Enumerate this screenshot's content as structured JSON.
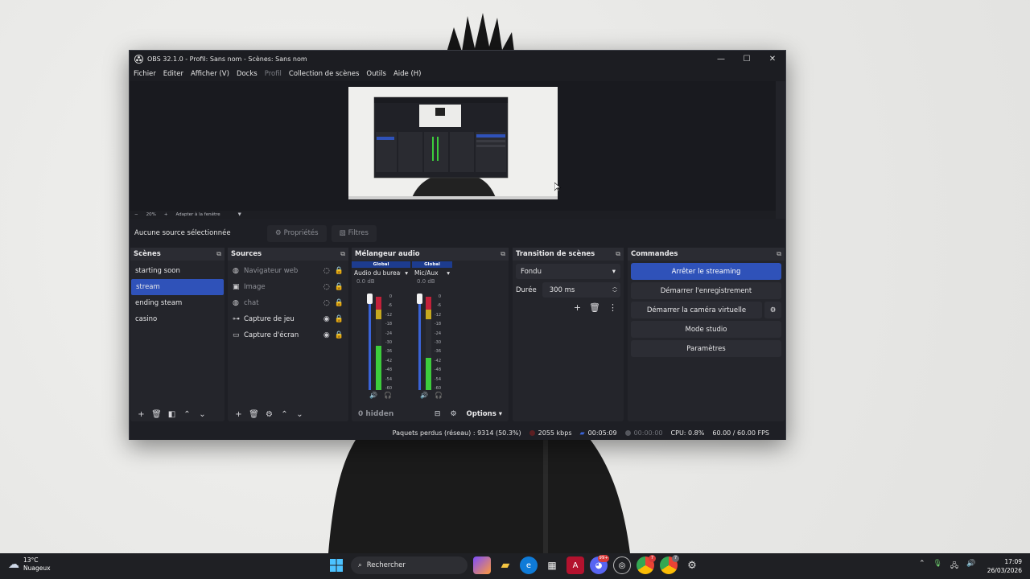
{
  "window": {
    "title": "OBS 32.1.0 - Profil: Sans nom - Scènes: Sans nom",
    "controls": {
      "minimize": "—",
      "maximize": "☐",
      "close": "✕"
    }
  },
  "menu": [
    "Fichier",
    "Editer",
    "Afficher (V)",
    "Docks",
    "Profil",
    "Collection de scènes",
    "Outils",
    "Aide (H)"
  ],
  "zoom_bar": {
    "minus": "−",
    "zoom": "20%",
    "plus": "+",
    "fit": "Adapter à la fenêtre"
  },
  "source_toolbar": {
    "no_selection": "Aucune source sélectionnée",
    "properties": "Propriétés",
    "filters": "Filtres"
  },
  "scenes": {
    "title": "Scènes",
    "items": [
      "starting soon",
      "stream",
      "ending steam",
      "casino"
    ],
    "selected_index": 1
  },
  "sources": {
    "title": "Sources",
    "items": [
      {
        "name": "Navigateur web",
        "icon": "globe-icon",
        "visible": false
      },
      {
        "name": "Image",
        "icon": "image-icon",
        "visible": false
      },
      {
        "name": "chat",
        "icon": "globe-icon",
        "visible": false
      },
      {
        "name": "Capture de jeu",
        "icon": "gamepad-icon",
        "visible": true
      },
      {
        "name": "Capture d'écran",
        "icon": "monitor-icon",
        "visible": true
      }
    ]
  },
  "mixer": {
    "title": "Mélangeur audio",
    "channels": [
      {
        "global": "Global",
        "name": "Audio du bureau",
        "db": "0.0 dB",
        "level": 0.62
      },
      {
        "global": "Global",
        "name": "Mic/Aux",
        "db": "0.0 dB",
        "level": 0.45
      }
    ],
    "scale": [
      "0",
      "-6",
      "-12",
      "-18",
      "-24",
      "-30",
      "-36",
      "-42",
      "-48",
      "-54",
      "-60"
    ],
    "hidden": "0 hidden",
    "options": "Options"
  },
  "transition": {
    "title": "Transition de scènes",
    "selected": "Fondu",
    "duration_label": "Durée",
    "duration_value": "300 ms"
  },
  "controls": {
    "title": "Commandes",
    "stop_streaming": "Arrêter le streaming",
    "start_recording": "Démarrer l'enregistrement",
    "start_virtual_cam": "Démarrer la caméra virtuelle",
    "studio_mode": "Mode studio",
    "settings": "Paramètres"
  },
  "status": {
    "dropped_frames": "Paquets perdus (réseau) : 9314 (50.3%)",
    "bitrate": "2055 kbps",
    "stream_time": "00:05:09",
    "record_time": "00:00:00",
    "cpu": "CPU: 0.8%",
    "fps": "60.00 / 60.00 FPS"
  },
  "taskbar": {
    "weather_temp": "13°C",
    "weather_desc": "Nuageux",
    "search_placeholder": "Rechercher",
    "badges": [
      "99+",
      "7",
      "7"
    ],
    "time": "17:09",
    "date": "26/03/2026"
  },
  "colors": {
    "accent": "#2f52b9",
    "streaming_dot": "#c0392b",
    "meter_green": "#3ccd3c",
    "meter_red": "#c2213a"
  }
}
